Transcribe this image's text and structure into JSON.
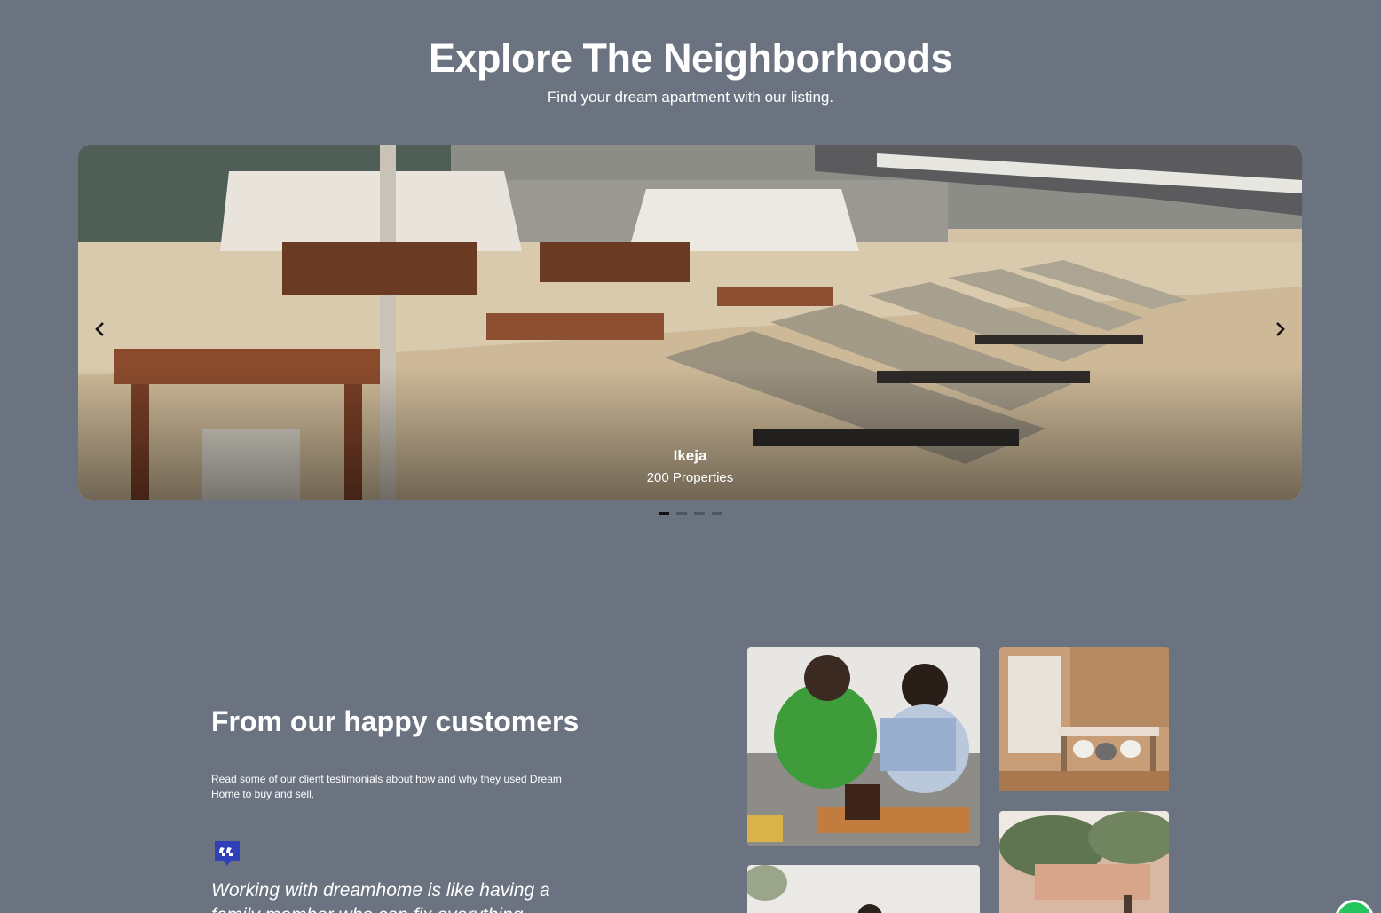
{
  "header": {
    "title": "Explore The Neighborhoods",
    "subtitle": "Find your dream apartment with our listing."
  },
  "carousel": {
    "slide": {
      "name": "Ikeja",
      "count": "200 Properties"
    },
    "dot_count": 4,
    "active_dot": 1,
    "prev_icon": "chevron-left-icon",
    "next_icon": "chevron-right-icon"
  },
  "testimonials": {
    "title": "From our happy customers",
    "description": "Read some of our client testimonials about how and why they used Dream Home to buy and sell.",
    "quote_icon": "quote-icon",
    "quote": "Working with dreamhome is like having a family member who can fix everything"
  },
  "colors": {
    "background": "#6b7280",
    "accent": "#2f3fb8",
    "dot_active": "#111111",
    "dot_inactive": "#4b5563",
    "chat": "#22c55e"
  }
}
